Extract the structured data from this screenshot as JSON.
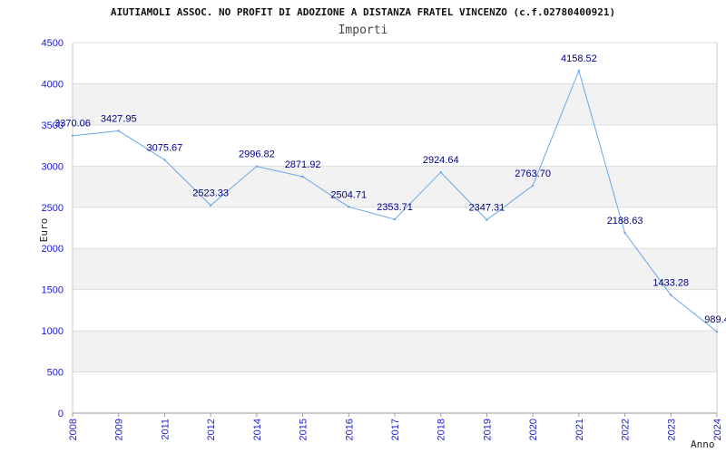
{
  "chart_data": {
    "type": "line",
    "title": "AIUTIAMOLI ASSOC. NO PROFIT DI ADOZIONE A DISTANZA FRATEL VINCENZO (c.f.02780400921)",
    "subtitle": "Importi",
    "xlabel": "Anno",
    "ylabel": "Euro",
    "ylim": [
      0,
      4500
    ],
    "yticks": [
      "0",
      "500",
      "1000",
      "1500",
      "2000",
      "2500",
      "3000",
      "3500",
      "4000",
      "4500"
    ],
    "grid": true,
    "categories": [
      "2008",
      "2009",
      "2011",
      "2012",
      "2014",
      "2015",
      "2016",
      "2017",
      "2018",
      "2019",
      "2020",
      "2021",
      "2022",
      "2023",
      "2024"
    ],
    "series": [
      {
        "values": [
          3370.06,
          3427.95,
          3075.67,
          2523.33,
          2996.82,
          2871.92,
          2504.71,
          2353.71,
          2924.64,
          2347.31,
          2763.7,
          4158.52,
          2188.63,
          1433.28,
          989.4
        ],
        "labels": [
          "3370.06",
          "3427.95",
          "3075.67",
          "2523.33",
          "2996.82",
          "2871.92",
          "2504.71",
          "2353.71",
          "2924.64",
          "2347.31",
          "2763.70",
          "4158.52",
          "2188.63",
          "1433.28",
          "989.4"
        ],
        "color": "#6aa6e8"
      }
    ],
    "colors": {
      "band": "#f2f2f2",
      "grid": "#dddddd",
      "axis": "#cccccc",
      "tick_text": "#1a1acc",
      "label_text": "#000088"
    }
  }
}
